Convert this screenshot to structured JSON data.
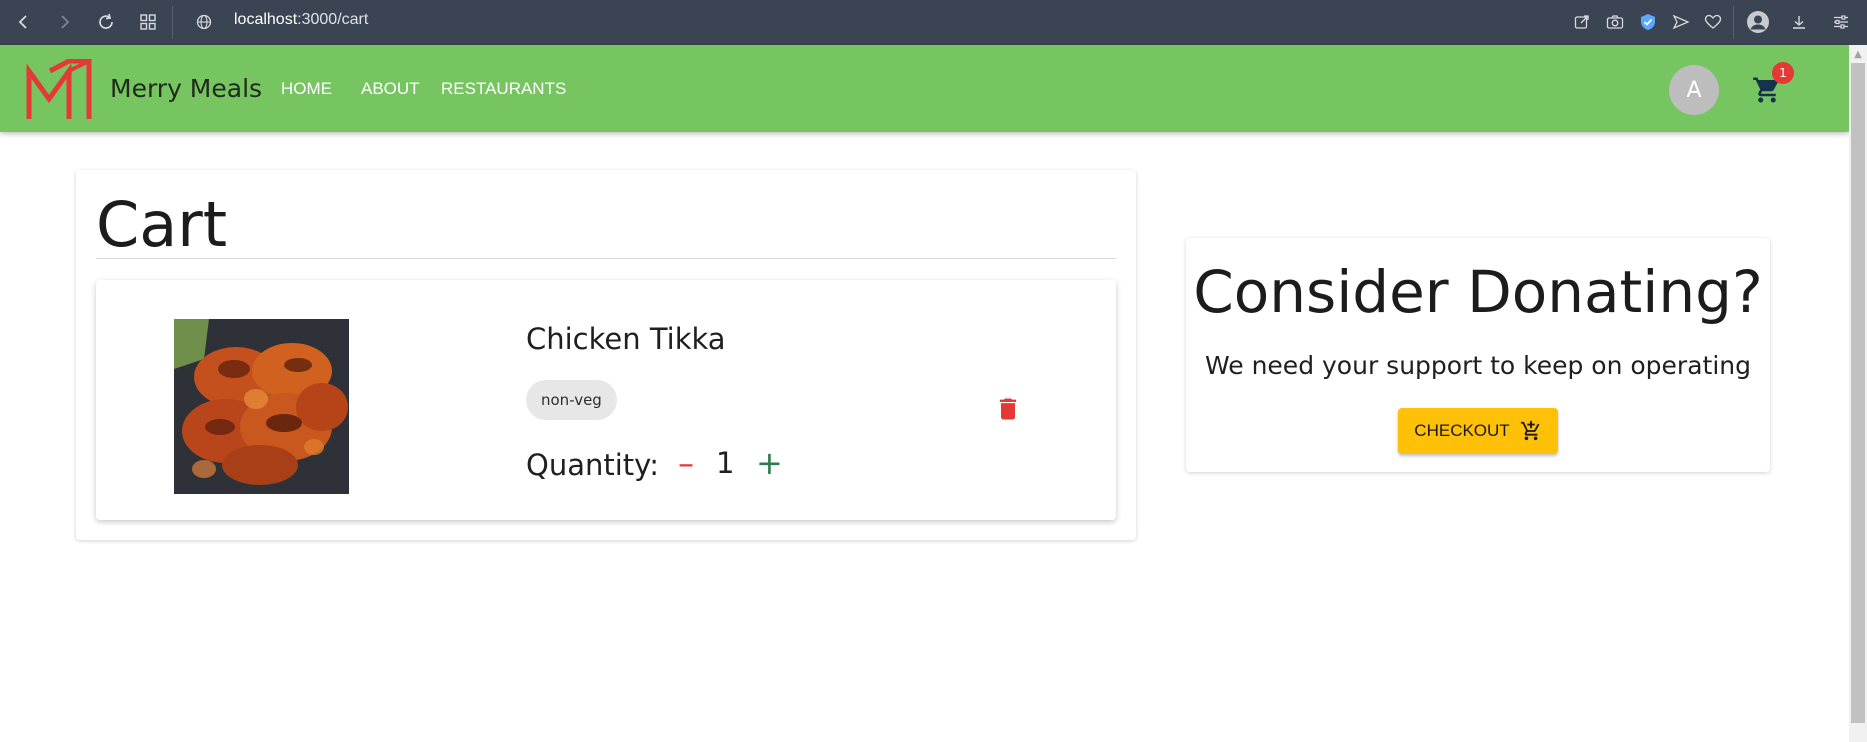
{
  "browser": {
    "url_host": "localhost",
    "url_path": ":3000/cart"
  },
  "navbar": {
    "brand": "Merry Meals",
    "links": [
      "HOME",
      "ABOUT",
      "RESTAURANTS"
    ],
    "avatar_initial": "A",
    "cart_count": "1",
    "colors": {
      "bar": "#76c561",
      "logo": "#e53935",
      "badge": "#e53935"
    }
  },
  "cart": {
    "title": "Cart",
    "items": [
      {
        "name": "Chicken Tikka",
        "tag": "non-veg",
        "quantity_label": "Quantity:",
        "quantity": "1",
        "minus_symbol": "–",
        "plus_symbol": "+"
      }
    ]
  },
  "donate": {
    "title": "Consider Donating?",
    "subtitle": "We need your support to keep on operating",
    "button_label": "CHECKOUT",
    "button_color": "#ffc107"
  }
}
